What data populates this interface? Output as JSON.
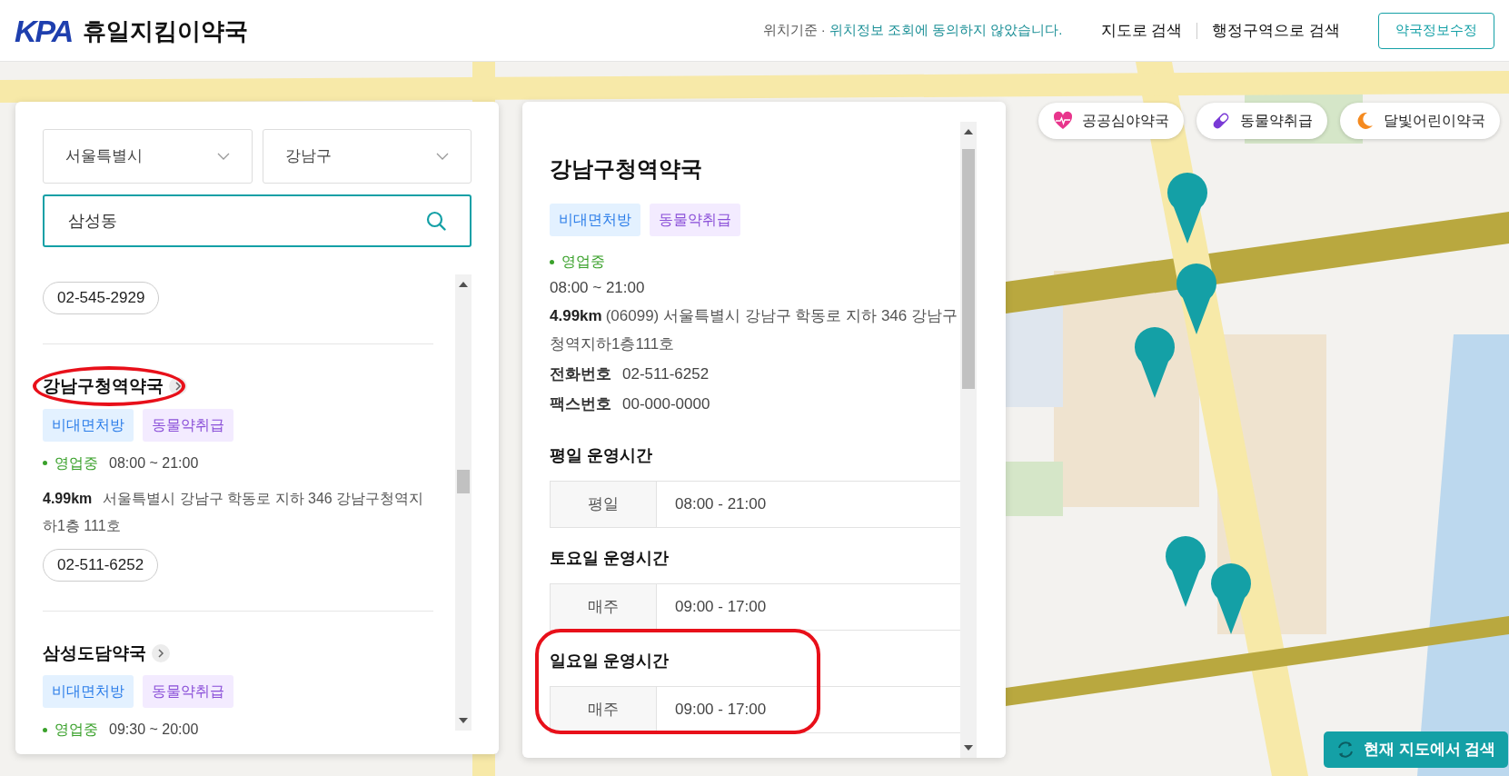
{
  "header": {
    "logo": "KPA",
    "title": "휴일지킴이약국",
    "location_prefix": "위치기준 ·",
    "location_message": "위치정보 조회에 동의하지 않았습니다.",
    "nav": [
      "지도로 검색",
      "행정구역으로 검색"
    ],
    "edit_button": "약국정보수정"
  },
  "search": {
    "city": "서울특별시",
    "district": "강남구",
    "query": "삼성동"
  },
  "results": [
    {
      "phone": "02-545-2929"
    },
    {
      "name": "강남구청역약국",
      "tags": [
        {
          "label": "비대면처방",
          "kind": "remote"
        },
        {
          "label": "동물약취급",
          "kind": "animal"
        }
      ],
      "status": "영업중",
      "open": true,
      "hours": "08:00 ~ 21:00",
      "distance": "4.99km",
      "address": "서울특별시 강남구 학동로 지하 346 강남구청역지하1층 111호",
      "phone": "02-511-6252"
    },
    {
      "name": "삼성도담약국",
      "tags": [
        {
          "label": "비대면처방",
          "kind": "remote"
        },
        {
          "label": "동물약취급",
          "kind": "animal"
        }
      ],
      "status": "영업중",
      "open": true,
      "hours": "09:30 ~ 20:00"
    }
  ],
  "detail": {
    "name": "강남구청역약국",
    "tags": [
      {
        "label": "비대면처방",
        "kind": "remote"
      },
      {
        "label": "동물약취급",
        "kind": "animal"
      }
    ],
    "status": "영업중",
    "open": true,
    "hours": "08:00 ~ 21:00",
    "distance": "4.99km",
    "address": "(06099) 서울특별시 강남구 학동로 지하 346 강남구청역지하1층111호",
    "phone_label": "전화번호",
    "phone": "02-511-6252",
    "fax_label": "팩스번호",
    "fax": "00-000-0000",
    "schedules": [
      {
        "heading": "평일 운영시간",
        "rows": [
          {
            "day": "평일",
            "hours": "08:00 - 21:00"
          }
        ]
      },
      {
        "heading": "토요일 운영시간",
        "rows": [
          {
            "day": "매주",
            "hours": "09:00 - 17:00"
          }
        ]
      },
      {
        "heading": "일요일 운영시간",
        "rows": [
          {
            "day": "매주",
            "hours": "09:00 - 17:00"
          }
        ]
      }
    ]
  },
  "filters": [
    {
      "label": "공공심야약국",
      "kind": "heart"
    },
    {
      "label": "동물약취급",
      "kind": "pill"
    },
    {
      "label": "달빛어린이약국",
      "kind": "moon"
    }
  ],
  "map_search_button": "현재 지도에서 검색"
}
